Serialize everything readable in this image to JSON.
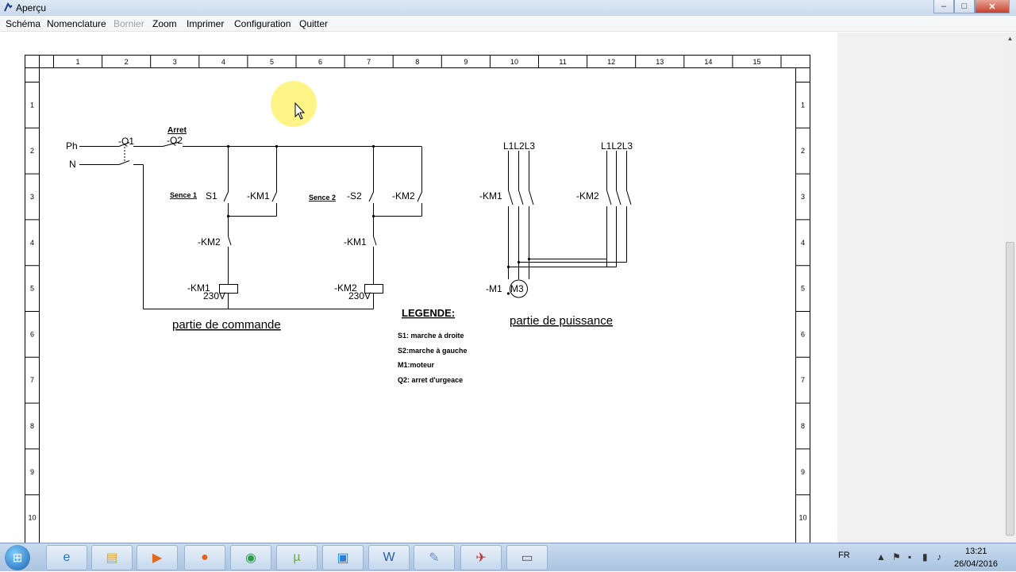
{
  "window": {
    "title": "Aperçu"
  },
  "menu": [
    {
      "label": "Schéma",
      "enabled": true
    },
    {
      "label": "Nomenclature",
      "enabled": true
    },
    {
      "label": "Bornier",
      "enabled": false
    },
    {
      "label": "Zoom",
      "enabled": true
    },
    {
      "label": "Imprimer",
      "enabled": true
    },
    {
      "label": "Configuration",
      "enabled": true
    },
    {
      "label": "Quitter",
      "enabled": true
    }
  ],
  "frame": {
    "columns": [
      "1",
      "2",
      "3",
      "4",
      "5",
      "6",
      "7",
      "8",
      "9",
      "10",
      "11",
      "12",
      "13",
      "14",
      "15"
    ],
    "rows": [
      "1",
      "2",
      "3",
      "4",
      "5",
      "6",
      "7",
      "8",
      "9",
      "10"
    ]
  },
  "schematic": {
    "supply_phase": "Ph",
    "supply_neutral": "N",
    "breaker": "-Q1",
    "stop_label": "Arret",
    "stop_switch": "-Q2",
    "sense1": "Sence 1",
    "s1": "S1",
    "km1_holding": "-KM1",
    "sense2": "Sence 2",
    "s2": "-S2",
    "km2_holding": "-KM2",
    "km2_interlock": "-KM2",
    "km1_interlock": "-KM1",
    "coil_km1": "-KM1",
    "coil_km2": "-KM2",
    "coil_voltage_1": "230V",
    "coil_voltage_2": "230V",
    "control_caption": "partie de commande",
    "power_supply_1": "L1L2L3",
    "power_supply_2": "L1L2L3",
    "power_km1": "-KM1",
    "power_km2": "-KM2",
    "motor_label": "-M1",
    "motor_symbol": "M3",
    "power_caption": "partie de puissance"
  },
  "legend": {
    "title": "LEGENDE:",
    "items": [
      "S1: marche à droite",
      "S2:marche à gauche",
      "M1:moteur",
      "Q2: arret d'urgeace"
    ]
  },
  "taskbar": {
    "items": [
      "windows-explorer",
      "internet-explorer",
      "file-manager",
      "media-player",
      "firefox",
      "chrome",
      "utorrent",
      "photo-viewer",
      "word",
      "paint",
      "drawing-tool",
      "application-window"
    ],
    "language": "FR",
    "time": "13:21",
    "date": "26/04/2016"
  },
  "colors": {
    "cursor_highlight": "#fff37a",
    "grid_line": "#000000"
  }
}
